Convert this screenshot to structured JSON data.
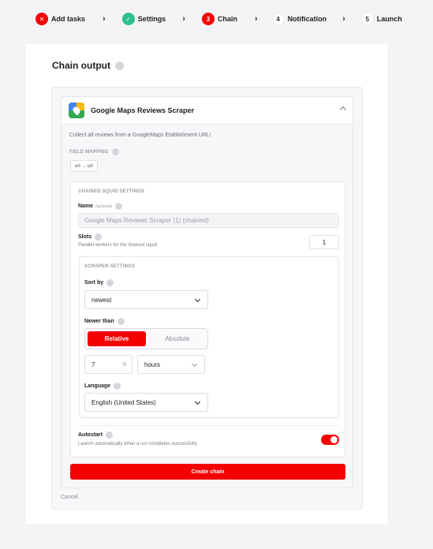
{
  "stepper": {
    "steps": [
      {
        "label": "Add tasks",
        "marker": "✕",
        "state": "error"
      },
      {
        "label": "Settings",
        "marker": "✓",
        "state": "done"
      },
      {
        "label": "Chain",
        "marker": "3",
        "state": "active"
      },
      {
        "label": "Notification",
        "marker": "4",
        "state": "pending"
      },
      {
        "label": "Launch",
        "marker": "5",
        "state": "pending"
      }
    ],
    "separator": "›"
  },
  "chain_output": {
    "title": "Chain output",
    "scraper": {
      "name": "Google Maps Reviews Scraper",
      "description": "Collect all reviews from a GoogleMaps Etablishment URL!",
      "field_mapping_label": "FIELD MAPPING",
      "mapping": "url → url"
    },
    "chained_settings": {
      "heading": "CHAINED SQUID SETTINGS",
      "name_label": "Name",
      "name_optional": "(optional)",
      "name_placeholder": "Google Maps Reviews Scraper (1) (chained)",
      "slots_label": "Slots",
      "slots_hint": "Parallel workers for the chained squid",
      "slots_value": "1"
    },
    "scraper_settings": {
      "heading": "SCRAPER SETTINGS",
      "sort_label": "Sort by",
      "sort_value": "newest",
      "newer_label": "Newer than",
      "relative_label": "Relative",
      "absolute_label": "Absolute",
      "amount_value": "7",
      "unit_value": "hours",
      "language_label": "Language",
      "language_value": "English (United States)"
    },
    "autostart": {
      "label": "Autostart",
      "hint": "Launch automatically when a run completes successfully",
      "enabled": true
    },
    "create_label": "Create chain",
    "cancel_label": "Cancel"
  },
  "colors": {
    "accent": "#f40000",
    "success": "#2ebf91"
  }
}
